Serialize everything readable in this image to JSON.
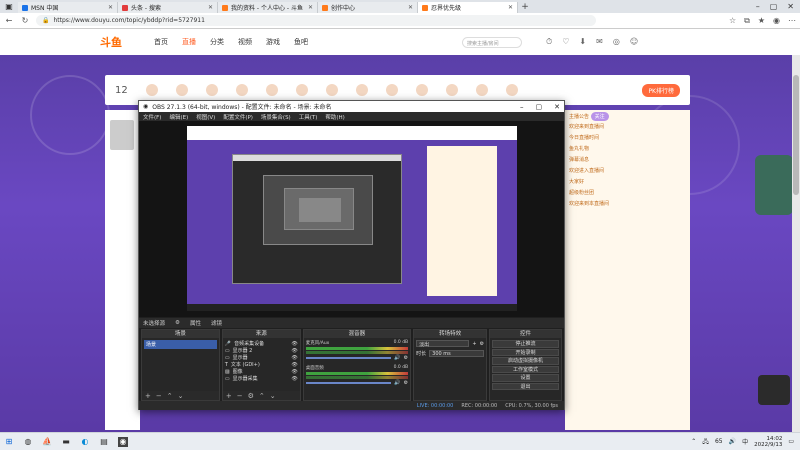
{
  "browser": {
    "tabs": [
      {
        "label": "MSN 中国",
        "color": "#1a73e8",
        "active": false
      },
      {
        "label": "头条 - 搜索",
        "color": "#e23c3c",
        "active": false
      },
      {
        "label": "我的资料 - 个人中心 - 斗鱼",
        "color": "#ff7a1a",
        "active": false
      },
      {
        "label": "创作中心",
        "color": "#ff7a1a",
        "active": false
      },
      {
        "label": "忍界优先级",
        "color": "#ff7a1a",
        "active": true
      }
    ],
    "url": "https://www.douyu.com/topic/ybddp?rid=5727911"
  },
  "site": {
    "logo": "斗鱼",
    "nav": [
      "首页",
      "直播",
      "分类",
      "视频",
      "游戏",
      "鱼吧"
    ],
    "active_nav": "直播",
    "search_placeholder": "搜索主播/房间"
  },
  "room": {
    "fans_count": "12",
    "pk_button": "PK排行榜"
  },
  "chat": {
    "rows": [
      "主播公告",
      "欢迎来到直播间",
      "今日直播时间",
      "鱼丸礼物",
      "弹幕消息",
      "欢迎进入直播间",
      "大家好",
      "超级粉丝团",
      "欢迎来到本直播间"
    ],
    "pill": "关注"
  },
  "obs": {
    "title": "OBS 27.1.3 (64-bit, windows) - 配置文件: 未命名 - 场景: 未命名",
    "menu": [
      "文件(F)",
      "编辑(E)",
      "视图(V)",
      "配置文件(P)",
      "场景集合(S)",
      "工具(T)",
      "帮助(H)"
    ],
    "studio_mode_label": "属性",
    "filter_label": "滤镜",
    "no_source": "未选择源",
    "docks": {
      "scenes": {
        "title": "场景",
        "items": [
          "场景"
        ]
      },
      "sources": {
        "title": "来源",
        "items": [
          "音频采集设备",
          "显示器 2",
          "显示器",
          "文本 (GDI+)",
          "图像",
          "显示器采集"
        ]
      },
      "mixer": {
        "title": "混音器",
        "channels": [
          {
            "name": "麦克风/Aux",
            "db": "0.0 dB"
          },
          {
            "name": "桌面音频",
            "db": "0.0 dB"
          }
        ]
      },
      "transitions": {
        "title": "转场特效",
        "type": "淡出",
        "duration_label": "时长",
        "duration": "300 ms"
      },
      "controls": {
        "title": "控件",
        "buttons": [
          "停止推流",
          "开始录制",
          "启动虚拟摄像机",
          "工作室模式",
          "设置",
          "退出"
        ]
      }
    },
    "status": {
      "live": "LIVE: 00:00:00",
      "rec": "REC: 00:00:00",
      "cpu": "CPU: 0.7%, 30.00 fps"
    }
  },
  "taskbar": {
    "lang": "中",
    "volume_hint": "65",
    "time": "14:02",
    "date": "2022/9/13"
  }
}
